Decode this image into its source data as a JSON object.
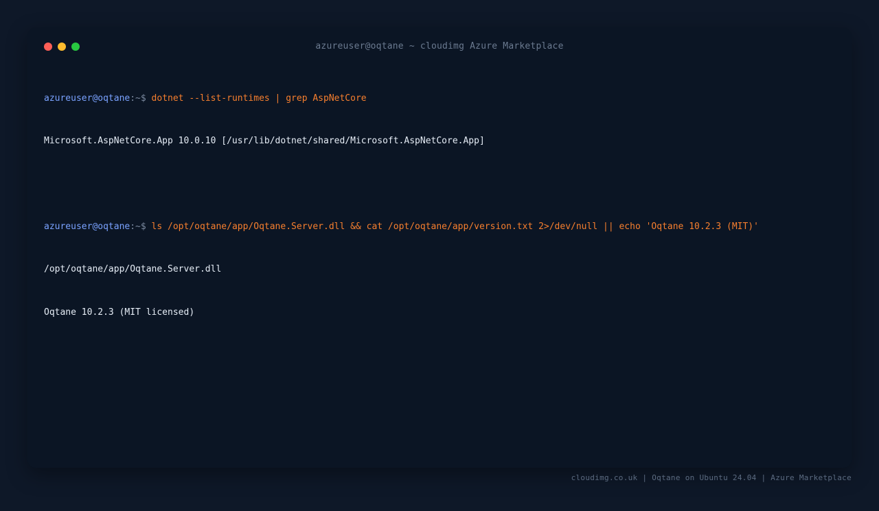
{
  "window": {
    "title": "azureuser@oqtane ~ cloudimg Azure Marketplace",
    "controls": [
      {
        "name": "close",
        "color": "#ff5f57"
      },
      {
        "name": "minimize",
        "color": "#febc2e"
      },
      {
        "name": "maximize",
        "color": "#28c840"
      }
    ]
  },
  "terminal": {
    "sessions": [
      {
        "prompt_user": "azureuser@oqtane",
        "prompt_path": ":~$",
        "command": "dotnet --list-runtimes | grep AspNetCore",
        "output": [
          "Microsoft.AspNetCore.App 10.0.10 [/usr/lib/dotnet/shared/Microsoft.AspNetCore.App]"
        ]
      },
      {
        "prompt_user": "azureuser@oqtane",
        "prompt_path": ":~$",
        "command": "ls /opt/oqtane/app/Oqtane.Server.dll && cat /opt/oqtane/app/version.txt 2>/dev/null || echo 'Oqtane 10.2.3 (MIT)'",
        "output": [
          "/opt/oqtane/app/Oqtane.Server.dll",
          "Oqtane 10.2.3 (MIT licensed)"
        ]
      }
    ]
  },
  "footer": {
    "text": "cloudimg.co.uk | Oqtane on Ubuntu 24.04 | Azure Marketplace"
  },
  "colors": {
    "page_background": "#0e1828",
    "terminal_background": "#0b1524",
    "prompt_user": "#7aa2ff",
    "prompt_path": "#7c8aa0",
    "command": "#f77f2e",
    "output": "#e6edf6"
  }
}
